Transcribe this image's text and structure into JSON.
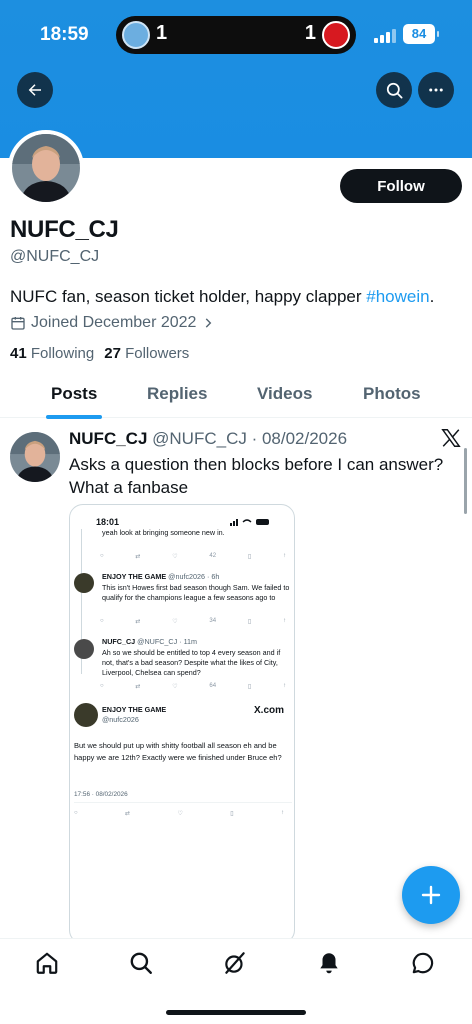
{
  "status_bar": {
    "time": "18:59",
    "live_activity": {
      "home_score": "1",
      "away_score": "1"
    },
    "battery": "84"
  },
  "header": {
    "back_icon": "arrow-left-icon",
    "search_icon": "search-icon",
    "more_icon": "more-horizontal-icon"
  },
  "profile": {
    "follow_label": "Follow",
    "display_name": "NUFC_CJ",
    "handle": "@NUFC_CJ",
    "bio_text": "NUFC fan, season ticket holder, happy clapper ",
    "bio_hashtag": "#howein",
    "bio_end": ".",
    "joined": "Joined December 2022",
    "following_count": "41",
    "following_label": "Following",
    "followers_count": "27",
    "followers_label": "Followers"
  },
  "tabs": [
    {
      "label": "Posts",
      "active": true
    },
    {
      "label": "Replies",
      "active": false
    },
    {
      "label": "Videos",
      "active": false
    },
    {
      "label": "Photos",
      "active": false
    }
  ],
  "post": {
    "name": "NUFC_CJ",
    "handle_date": "@NUFC_CJ · 08/02/2026",
    "text": "Asks a question then blocks before I can answer? What a fanbase"
  },
  "embedded_screenshot": {
    "time": "18:01",
    "top_text": "yeah look at bringing someone new in.",
    "top_views": "42",
    "reply1": {
      "name": "ENJOY THE GAME",
      "meta": "@nufc2026 · 6h",
      "text": "This isn't Howes first bad season though Sam. We failed to qualify for the champions league a few seasons ago to",
      "views": "34"
    },
    "reply2": {
      "name": "NUFC_CJ",
      "meta": "@NUFC_CJ · 11m",
      "text": "Ah so we should be entitled to top 4 every season and if not, that's a bad season? Despite what the likes of City, Liverpool, Chelsea can spend?",
      "views": "64"
    },
    "main": {
      "name": "ENJOY THE GAME",
      "handle": "@nufc2026",
      "site": "X.com",
      "text": "But we should put up with shitty football all season eh and be happy we are 12th? Exactly were we finished under Bruce eh?",
      "timestamp": "17:56 · 08/02/2026"
    }
  },
  "fab": {
    "icon": "compose-plus-icon"
  },
  "bottom_nav": [
    {
      "name": "home-icon"
    },
    {
      "name": "search-icon"
    },
    {
      "name": "grok-icon"
    },
    {
      "name": "notifications-icon"
    },
    {
      "name": "messages-icon"
    }
  ],
  "colors": {
    "banner": "#1a8de2",
    "accent": "#1d9bf0",
    "text": "#0f1419",
    "secondary": "#536471"
  }
}
